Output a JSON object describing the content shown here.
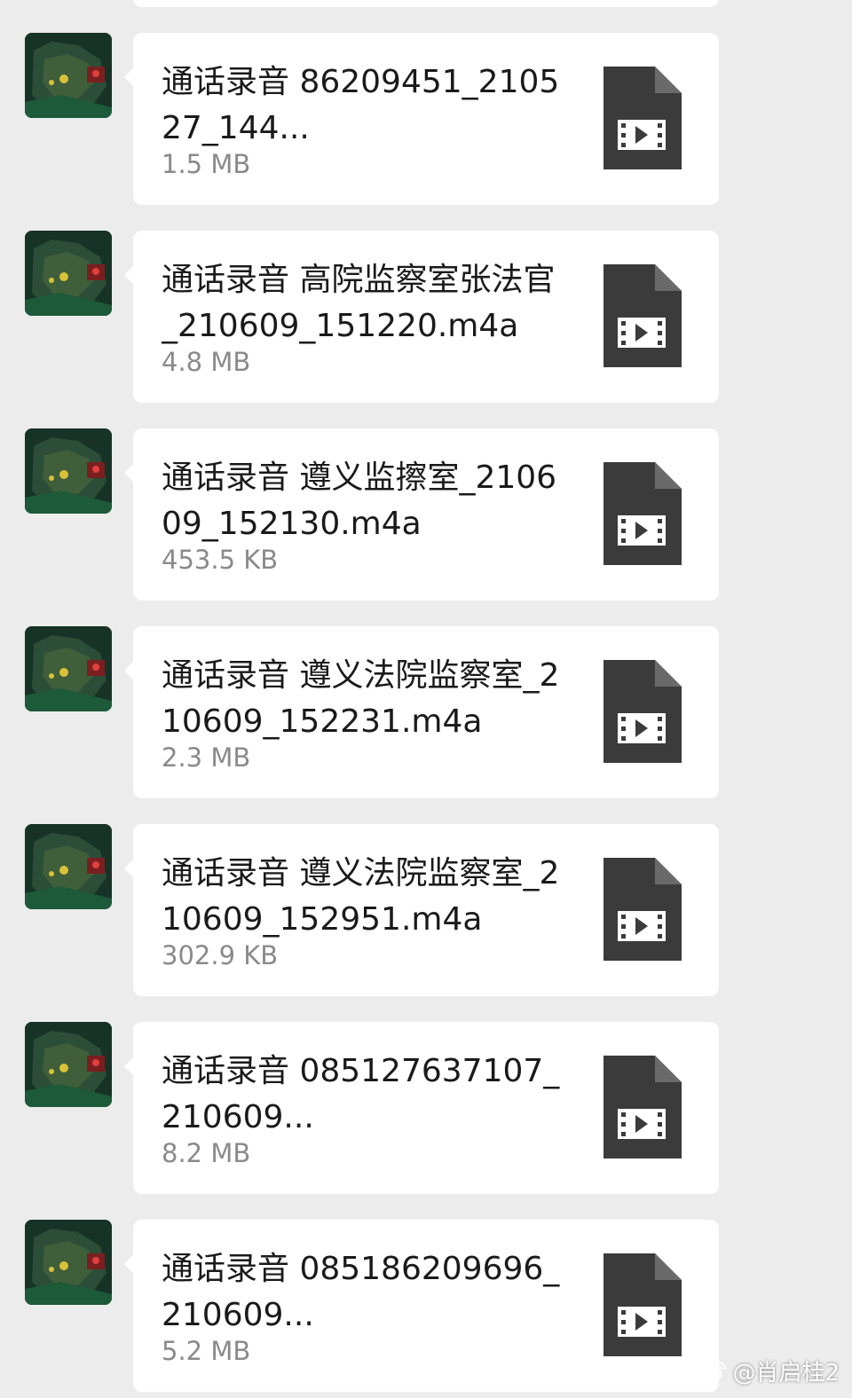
{
  "messages": [
    {
      "file_name": "通话录音 86209451_210527_144...",
      "file_size": "1.5 MB",
      "icon": "video-file-icon"
    },
    {
      "file_name": "通话录音 高院监察室张法官_210609_151220.m4a",
      "file_size": "4.8 MB",
      "icon": "video-file-icon"
    },
    {
      "file_name": "通话录音 遵义监擦室_210609_152130.m4a",
      "file_size": "453.5 KB",
      "icon": "video-file-icon"
    },
    {
      "file_name": "通话录音 遵义法院监察室_210609_152231.m4a",
      "file_size": "2.3 MB",
      "icon": "video-file-icon"
    },
    {
      "file_name": "通话录音 遵义法院监察室_210609_152951.m4a",
      "file_size": "302.9 KB",
      "icon": "video-file-icon"
    },
    {
      "file_name": "通话录音 085127637107_210609...",
      "file_size": "8.2 MB",
      "icon": "video-file-icon"
    },
    {
      "file_name": "通话录音 085186209696_210609...",
      "file_size": "5.2 MB",
      "icon": "video-file-icon"
    }
  ],
  "watermark": {
    "text": "@肖启桂2",
    "icon": "weibo-icon"
  },
  "colors": {
    "background": "#ececec",
    "bubble": "#ffffff",
    "file_icon": "#3b3b3b",
    "size_text": "#8a8a8a"
  }
}
